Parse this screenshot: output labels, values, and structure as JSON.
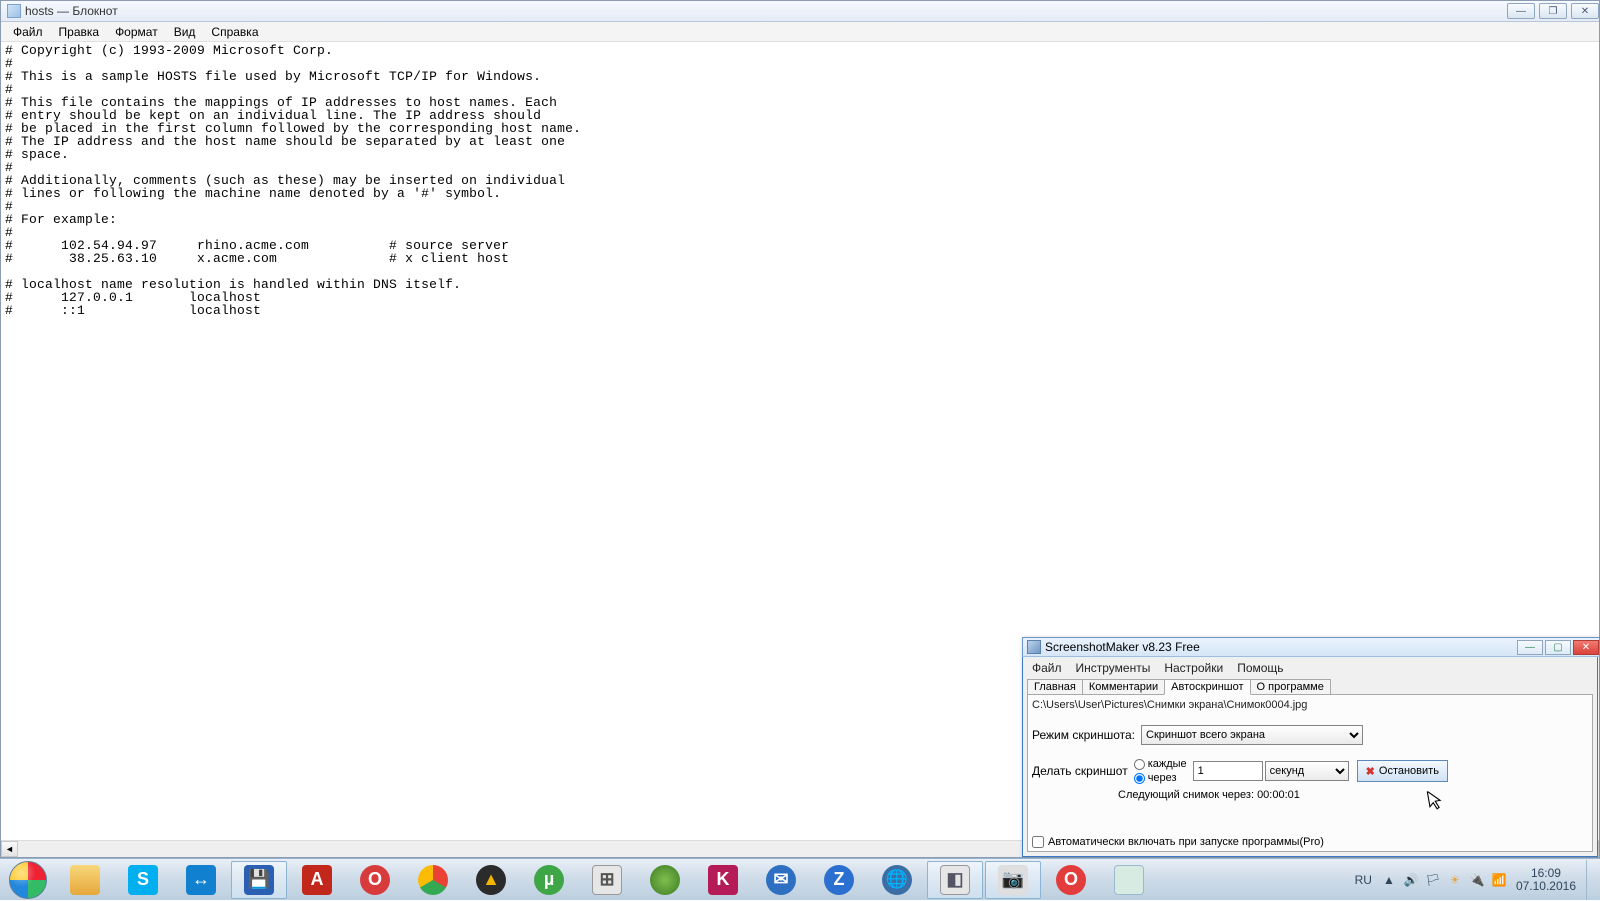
{
  "notepad": {
    "title": "hosts — Блокнот",
    "menu": [
      "Файл",
      "Правка",
      "Формат",
      "Вид",
      "Справка"
    ],
    "content": "# Copyright (c) 1993-2009 Microsoft Corp.\n#\n# This is a sample HOSTS file used by Microsoft TCP/IP for Windows.\n#\n# This file contains the mappings of IP addresses to host names. Each\n# entry should be kept on an individual line. The IP address should\n# be placed in the first column followed by the corresponding host name.\n# The IP address and the host name should be separated by at least one\n# space.\n#\n# Additionally, comments (such as these) may be inserted on individual\n# lines or following the machine name denoted by a '#' symbol.\n#\n# For example:\n#\n#      102.54.94.97     rhino.acme.com          # source server\n#       38.25.63.10     x.acme.com              # x client host\n\n# localhost name resolution is handled within DNS itself.\n#      127.0.0.1       localhost\n#      ::1             localhost"
  },
  "ssm": {
    "title": "ScreenshotMaker v8.23 Free",
    "menu": [
      "Файл",
      "Инструменты",
      "Настройки",
      "Помощь"
    ],
    "tabs": [
      "Главная",
      "Комментарии",
      "Автоскриншот",
      "О программе"
    ],
    "active_tab": 2,
    "path": "C:\\Users\\User\\Pictures\\Снимки экрана\\Снимок0004.jpg",
    "mode_label": "Режим скриншота:",
    "mode_value": "Скриншот всего экрана",
    "make_label": "Делать скриншот",
    "radio_every": "каждые",
    "radio_after": "через",
    "interval_value": "1",
    "unit_value": "секунд",
    "stop_label": "Остановить",
    "next_label": "Следующий снимок через: 00:00:01",
    "autostart_label": "Автоматически включать при запуске программы(Pro)"
  },
  "taskbar": {
    "lang": "RU",
    "time": "16:09",
    "date": "07.10.2016"
  }
}
